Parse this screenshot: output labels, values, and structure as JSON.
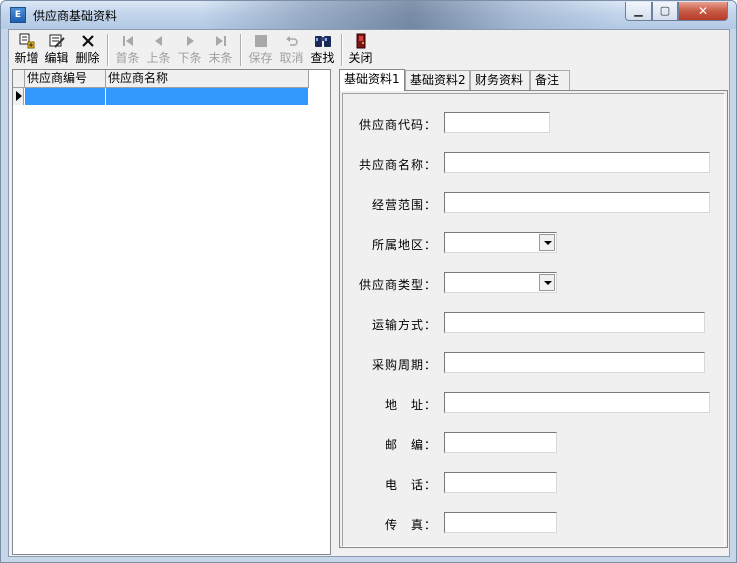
{
  "window": {
    "title": "供应商基础资料",
    "icon": "app-icon"
  },
  "toolbar": {
    "new_label": "新增",
    "edit_label": "编辑",
    "delete_label": "删除",
    "first_label": "首条",
    "prev_label": "上条",
    "next_label": "下条",
    "last_label": "末条",
    "save_label": "保存",
    "cancel_label": "取消",
    "find_label": "查找",
    "close_label": "关闭"
  },
  "grid": {
    "columns": [
      "供应商编号",
      "供应商名称"
    ]
  },
  "tabs": [
    "基础资料1",
    "基础资料2",
    "财务资料",
    "备注"
  ],
  "form": {
    "code_label": "供应商代码：",
    "name_label": "共应商名称：",
    "scope_label": "经营范围：",
    "region_label": "所属地区：",
    "type_label": "供应商类型：",
    "transport_label": "运输方式：",
    "cycle_label": "采购周期：",
    "address_label": "地　址：",
    "zip_label": "邮　编：",
    "phone_label": "电　话：",
    "fax_label": "传　真："
  }
}
